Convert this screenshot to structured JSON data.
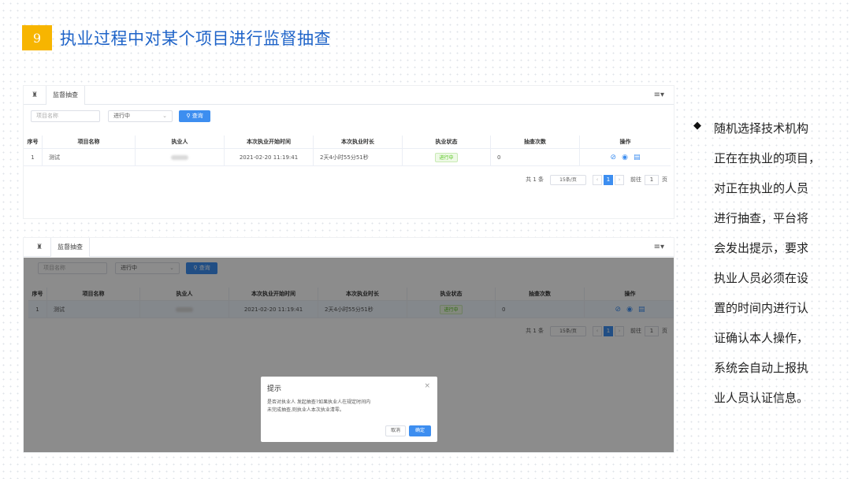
{
  "slide": {
    "number": "9",
    "title": "执业过程中对某个项目进行监督抽查",
    "bullet_lines": [
      "随机选择技术机构",
      "正在在执业的项目，",
      "对正在执业的人员",
      "进行抽查，平台将",
      "会发出提示，要求",
      "执业人员必须在设",
      "置的时间内进行认",
      "证确认本人操作，",
      "系统会自动上报执",
      "业人员认证信息。"
    ]
  },
  "screen1": {
    "tab_label": "监督抽查",
    "search": {
      "name_placeholder": "项目名称",
      "status_value": "进行中",
      "search_button": "查询"
    },
    "columns": [
      "序号",
      "项目名称",
      "执业人",
      "本次执业开始时间",
      "本次执业时长",
      "执业状态",
      "抽查次数",
      "操作"
    ],
    "row": {
      "index": "1",
      "project": "测试",
      "start_time": "2021-02-20 11:19:41",
      "duration": "2天4小时55分51秒",
      "status": "进行中",
      "checks": "0"
    },
    "pager": {
      "total": "共 1 条",
      "page_size": "15条/页",
      "current": "1",
      "goto_label": "前往",
      "goto_value": "1",
      "page_unit": "页"
    }
  },
  "screen2": {
    "tab_label": "监督抽查",
    "search": {
      "name_placeholder": "项目名称",
      "status_value": "进行中",
      "search_button": "查询"
    },
    "columns": [
      "序号",
      "项目名称",
      "执业人",
      "本次执业开始时间",
      "本次执业时长",
      "执业状态",
      "抽查次数",
      "操作"
    ],
    "row": {
      "index": "1",
      "project": "测试",
      "start_time": "2021-02-20 11:19:41",
      "duration": "2天4小时55分51秒",
      "status": "进行中",
      "checks": "0"
    },
    "pager": {
      "total": "共 1 条",
      "page_size": "15条/页",
      "current": "1",
      "goto_label": "前往",
      "goto_value": "1",
      "page_unit": "页"
    },
    "dialog": {
      "title": "提示",
      "message_line1": "是否对执业人 发起抽查?如果执业人在规定时间内",
      "message_line2": "未完成抽查,则执业人本次执业清零。",
      "cancel": "取消",
      "confirm": "确定"
    }
  },
  "colors": {
    "accent": "#3d8ef0",
    "title_blue": "#1e63c8",
    "badge_yellow": "#f7b500"
  }
}
